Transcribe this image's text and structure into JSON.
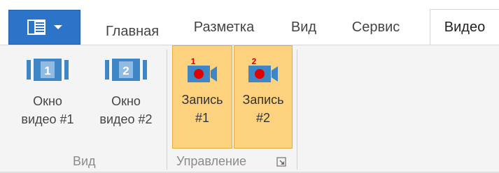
{
  "tabs": {
    "glavnaya": "Главная",
    "razmetka": "Разметка",
    "vid": "Вид",
    "servis": "Сервис",
    "video": "Видео"
  },
  "active_tab": "Видео",
  "groups": {
    "view": {
      "label": "Вид",
      "buttons": [
        {
          "line1": "Окно",
          "line2": "видео #1",
          "icon": "video-window-1-icon",
          "badge": "1"
        },
        {
          "line1": "Окно",
          "line2": "видео #2",
          "icon": "video-window-2-icon",
          "badge": "2"
        }
      ]
    },
    "control": {
      "label": "Управление",
      "buttons": [
        {
          "line1": "Запись",
          "line2": "#1",
          "icon": "record-camera-1-icon",
          "badge": "1",
          "active": true
        },
        {
          "line1": "Запись",
          "line2": "#2",
          "icon": "record-camera-2-icon",
          "badge": "2",
          "active": true
        }
      ]
    }
  },
  "colors": {
    "app_menu": "#2b74c7",
    "record_active_bg": "#fcd27e",
    "record_dot": "#e00000",
    "window_icon": "#3f86c6"
  }
}
